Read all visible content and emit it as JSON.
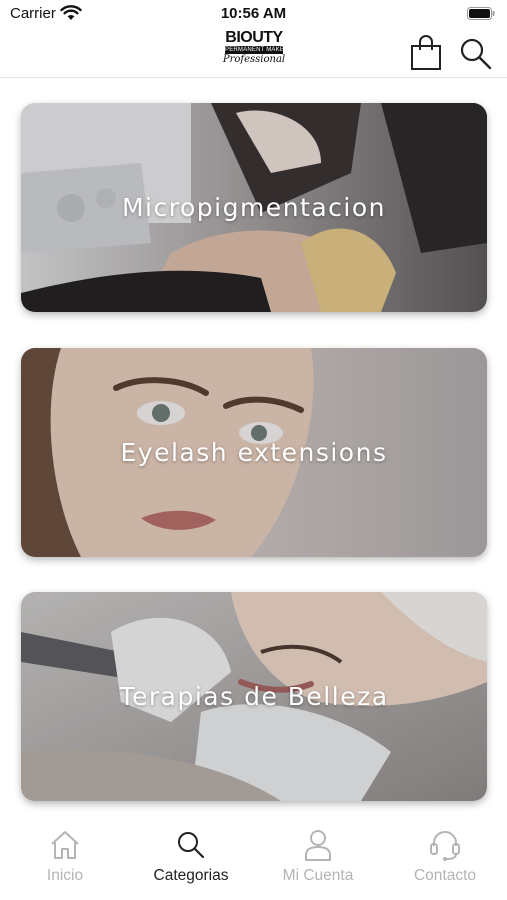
{
  "status_bar": {
    "carrier": "Carrier",
    "time": "10:56 AM"
  },
  "header": {
    "logo_main": "BIOUTY",
    "logo_strip": "PERMANENT MAKE-UP",
    "logo_script": "Professional",
    "icons": [
      "shopping-bag-icon",
      "search-icon"
    ]
  },
  "categories": [
    {
      "label": "Micropigmentacion"
    },
    {
      "label": "Eyelash extensions"
    },
    {
      "label": "Terapias de Belleza"
    }
  ],
  "tab_bar": {
    "tabs": [
      {
        "label": "Inicio",
        "icon": "home-icon",
        "active": false
      },
      {
        "label": "Categorias",
        "icon": "search-icon",
        "active": true
      },
      {
        "label": "Mi Cuenta",
        "icon": "user-icon",
        "active": false
      },
      {
        "label": "Contacto",
        "icon": "headset-icon",
        "active": false
      }
    ],
    "active_color": "#222222",
    "inactive_color": "#b4b4b4"
  }
}
